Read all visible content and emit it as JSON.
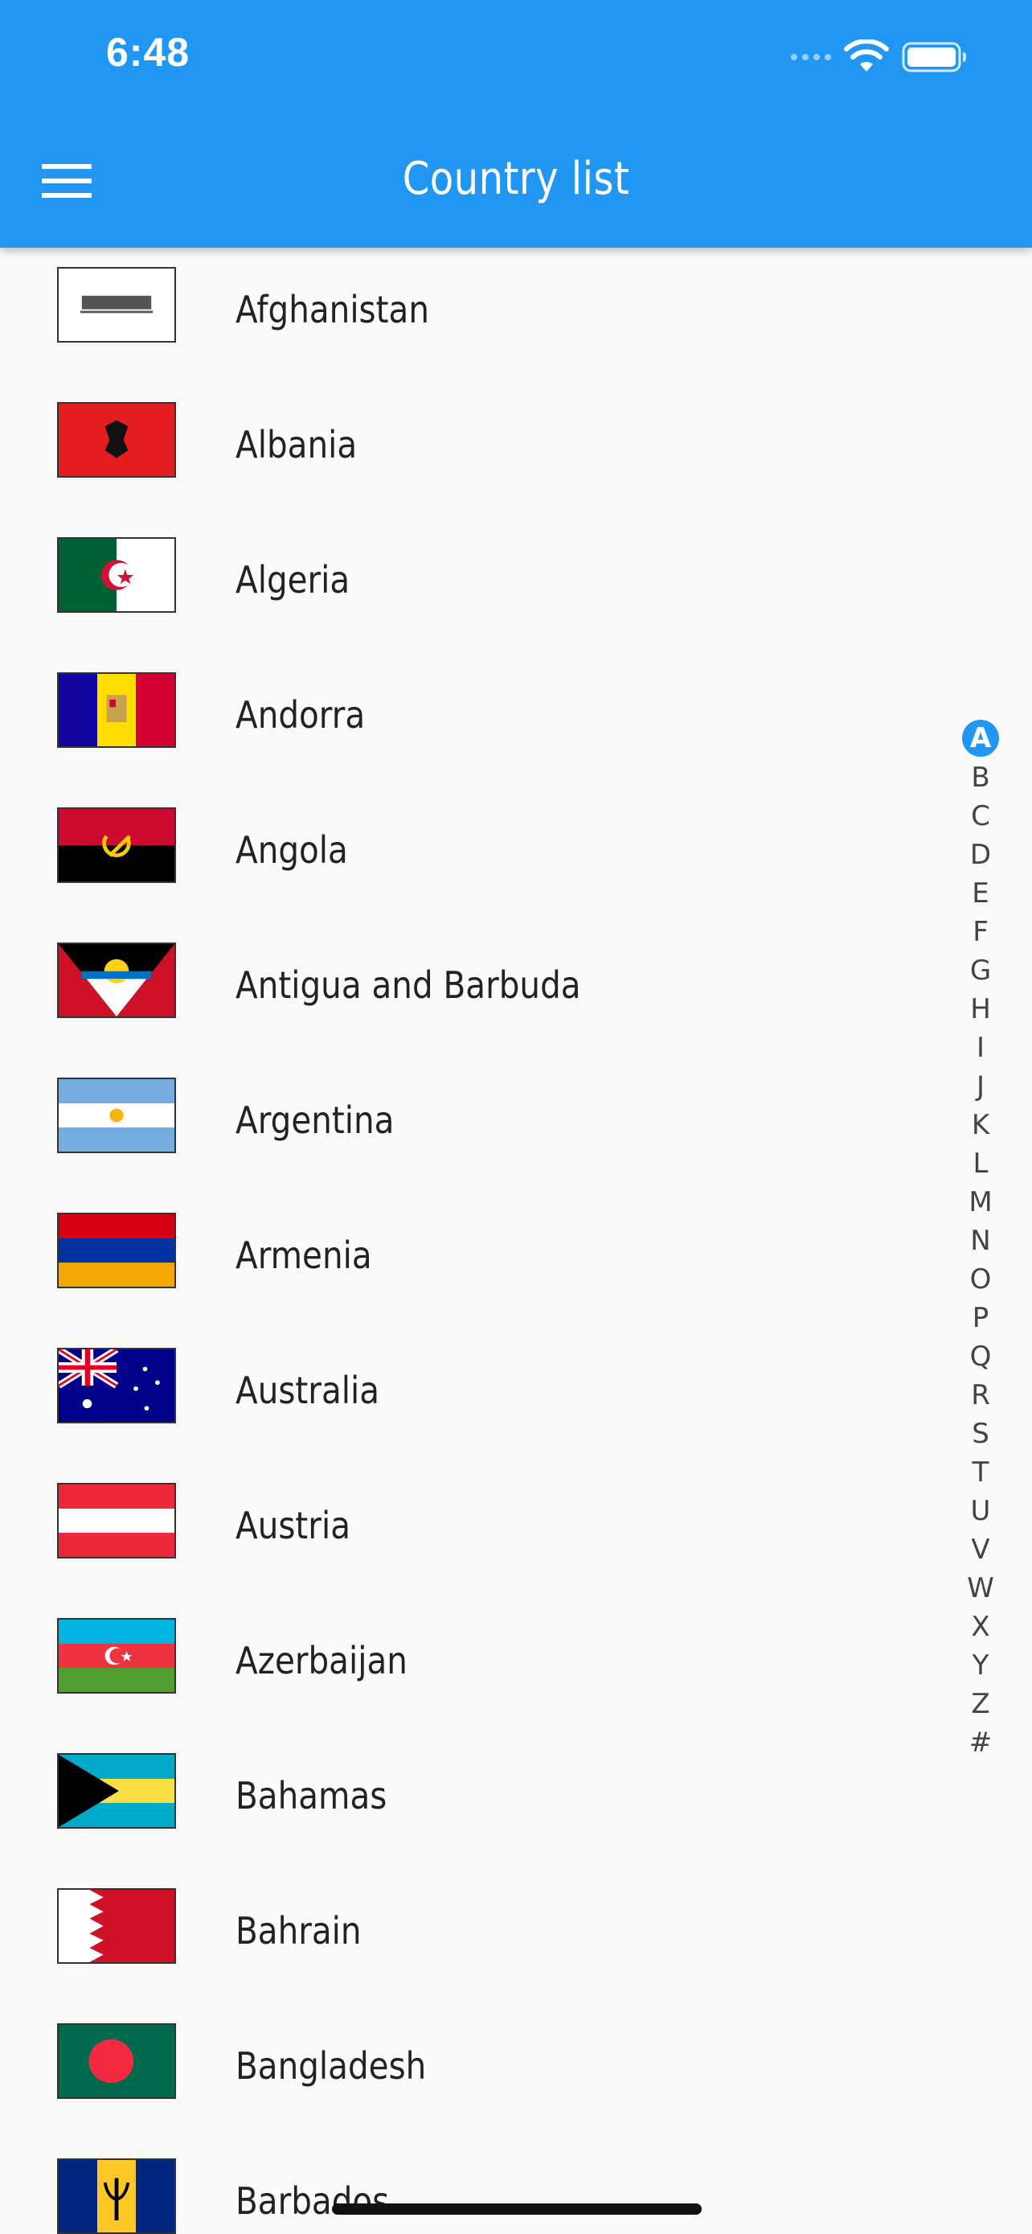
{
  "status_bar": {
    "time": "6:48"
  },
  "app_bar": {
    "title": "Country list"
  },
  "countries": [
    {
      "name": "Afghanistan",
      "flag_icon": "afghanistan-flag-icon"
    },
    {
      "name": "Albania",
      "flag_icon": "albania-flag-icon"
    },
    {
      "name": "Algeria",
      "flag_icon": "algeria-flag-icon"
    },
    {
      "name": "Andorra",
      "flag_icon": "andorra-flag-icon"
    },
    {
      "name": "Angola",
      "flag_icon": "angola-flag-icon"
    },
    {
      "name": "Antigua and Barbuda",
      "flag_icon": "antigua-and-barbuda-flag-icon"
    },
    {
      "name": "Argentina",
      "flag_icon": "argentina-flag-icon"
    },
    {
      "name": "Armenia",
      "flag_icon": "armenia-flag-icon"
    },
    {
      "name": "Australia",
      "flag_icon": "australia-flag-icon"
    },
    {
      "name": "Austria",
      "flag_icon": "austria-flag-icon"
    },
    {
      "name": "Azerbaijan",
      "flag_icon": "azerbaijan-flag-icon"
    },
    {
      "name": "Bahamas",
      "flag_icon": "bahamas-flag-icon"
    },
    {
      "name": "Bahrain",
      "flag_icon": "bahrain-flag-icon"
    },
    {
      "name": "Bangladesh",
      "flag_icon": "bangladesh-flag-icon"
    },
    {
      "name": "Barbados",
      "flag_icon": "barbados-flag-icon"
    }
  ],
  "alphabet_index": {
    "letters": [
      "A",
      "B",
      "C",
      "D",
      "E",
      "F",
      "G",
      "H",
      "I",
      "J",
      "K",
      "L",
      "M",
      "N",
      "O",
      "P",
      "Q",
      "R",
      "S",
      "T",
      "U",
      "V",
      "W",
      "X",
      "Y",
      "Z",
      "#"
    ],
    "selected": "A"
  },
  "colors": {
    "accent": "#2196f3",
    "background": "#fafafa",
    "text": "#222222"
  }
}
